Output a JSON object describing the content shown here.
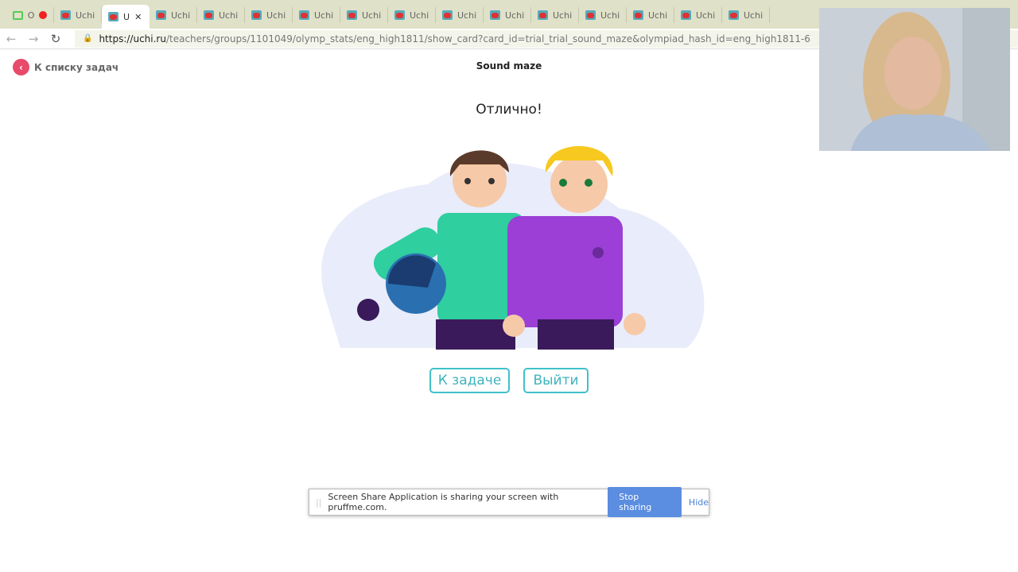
{
  "browser": {
    "tabs": [
      {
        "label": "O",
        "active": false
      },
      {
        "label": "Uchi",
        "active": false
      },
      {
        "label": "U",
        "active": true
      },
      {
        "label": "Uchi"
      },
      {
        "label": "Uchi"
      },
      {
        "label": "Uchi"
      },
      {
        "label": "Uchi"
      },
      {
        "label": "Uchi"
      },
      {
        "label": "Uchi"
      },
      {
        "label": "Uchi"
      },
      {
        "label": "Uchi"
      },
      {
        "label": "Uchi"
      },
      {
        "label": "Uchi"
      },
      {
        "label": "Uchi"
      },
      {
        "label": "Uchi"
      },
      {
        "label": "Uchi"
      }
    ],
    "url_domain": "https://uchi.ru",
    "url_path": "/teachers/groups/1101049/olymp_stats/eng_high1811/show_card?card_id=trial_trial_sound_maze&olympiad_hash_id=eng_high1811-6"
  },
  "page": {
    "back_label": "К списку задач",
    "title": "Sound maze",
    "message": "Отлично!",
    "to_task_label": "К задаче",
    "exit_label": "Выйти"
  },
  "share_bar": {
    "text": "Screen Share Application is sharing your screen with pruffme.com.",
    "stop_label": "Stop sharing",
    "hide_label": "Hide"
  },
  "colors": {
    "accent": "#3fc1c9",
    "back": "#e84a6a",
    "stop": "#5b8de0"
  }
}
